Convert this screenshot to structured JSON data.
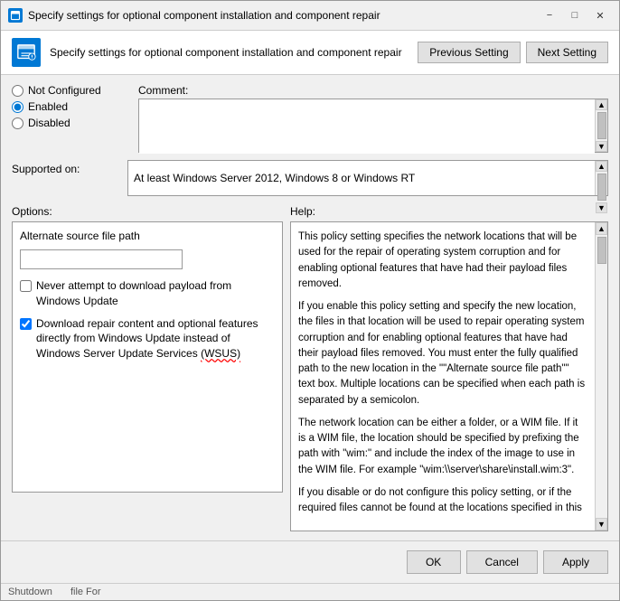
{
  "titleBar": {
    "text": "Specify settings for optional component installation and component repair",
    "minimizeLabel": "−",
    "maximizeLabel": "□",
    "closeLabel": "✕"
  },
  "header": {
    "title": "Specify settings for optional component installation and component repair",
    "prevButton": "Previous Setting",
    "nextButton": "Next Setting"
  },
  "radioGroup": {
    "notConfigured": "Not Configured",
    "enabled": "Enabled",
    "disabled": "Disabled"
  },
  "comment": {
    "label": "Comment:"
  },
  "supported": {
    "label": "Supported on:",
    "value": "At least Windows Server 2012, Windows 8 or Windows RT"
  },
  "options": {
    "header": "Options:",
    "boxTitle": "Alternate source file path",
    "inputPlaceholder": "",
    "checkbox1": "Never attempt to download payload from Windows Update",
    "checkbox2Label1": "Download repair content and optional features directly from Windows Update instead of Windows Server Update Services (WSUS)"
  },
  "help": {
    "header": "Help:",
    "paragraphs": [
      "This policy setting specifies the network locations that will be used for the repair of operating system corruption and for enabling optional features that have had their payload files removed.",
      "If you enable this policy setting and specify the new location, the files in that location will be used to repair operating system corruption and for enabling optional features that have had their payload files removed. You must enter the fully qualified path to the new location in the \"\"Alternate source file path\"\" text box. Multiple locations can be specified when each path is separated by a semicolon.",
      "The network location can be either a folder, or a WIM file. If it is a WIM file, the location should be specified by prefixing the path with \"wim:\" and include the index of the image to use in the WIM file. For example \"wim:\\\\server\\share\\install.wim:3\".",
      "If you disable or do not configure this policy setting, or if the required files cannot be found at the locations specified in this"
    ]
  },
  "buttons": {
    "ok": "OK",
    "cancel": "Cancel",
    "apply": "Apply"
  },
  "taskbar": {
    "item1": "Shutdown",
    "item2": "file  For"
  }
}
